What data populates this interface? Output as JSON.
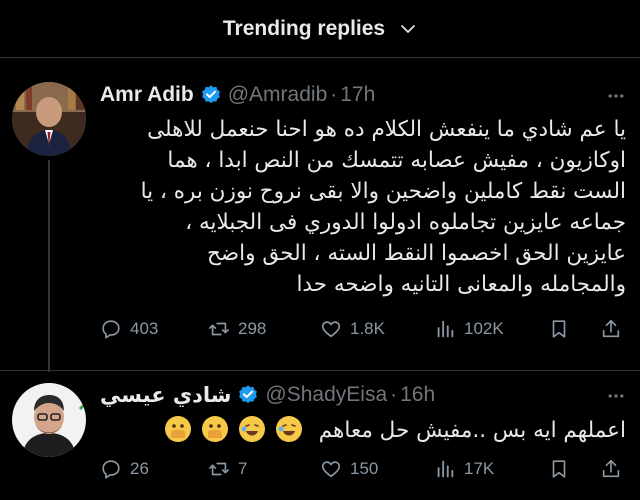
{
  "header": {
    "title": "Trending replies"
  },
  "tweets": [
    {
      "name": "Amr Adib",
      "handle": "@Amradib",
      "time": "17h",
      "text": "يا عم شادي ما ينفعش الكلام ده هو احنا حنعمل للاهلى\nاوكازيون ، مفيش عصابه تتمسك من النص ابدا ، هما\nالست نقط كاملين واضحين والا بقى نروح نوزن بره ، يا\nجماعه عايزين تجاملوه ادولوا الدوري فى الجبلايه ،\nعايزين الحق اخصموا النقط السته ، الحق واضح\nوالمجامله والمعانى التانيه واضحه حدا",
      "replies": "403",
      "reposts": "298",
      "likes": "1.8K",
      "views": "102K"
    },
    {
      "name": "شادي عيسي",
      "handle": "@ShadyEisa",
      "time": "16h",
      "text": "اعملهم ايه بس ..مفيش حل معاهم",
      "replies": "26",
      "reposts": "7",
      "likes": "150",
      "views": "17K"
    }
  ],
  "icons": [
    "chevron-down-icon",
    "verified-badge-icon",
    "more-icon",
    "reply-icon",
    "repost-icon",
    "like-icon",
    "views-icon",
    "bookmark-icon",
    "share-icon"
  ],
  "colors": {
    "background": "#000000",
    "text": "#e7e9ea",
    "muted": "#71767b",
    "verified": "#1d9bf0",
    "divider": "#2f3336"
  }
}
